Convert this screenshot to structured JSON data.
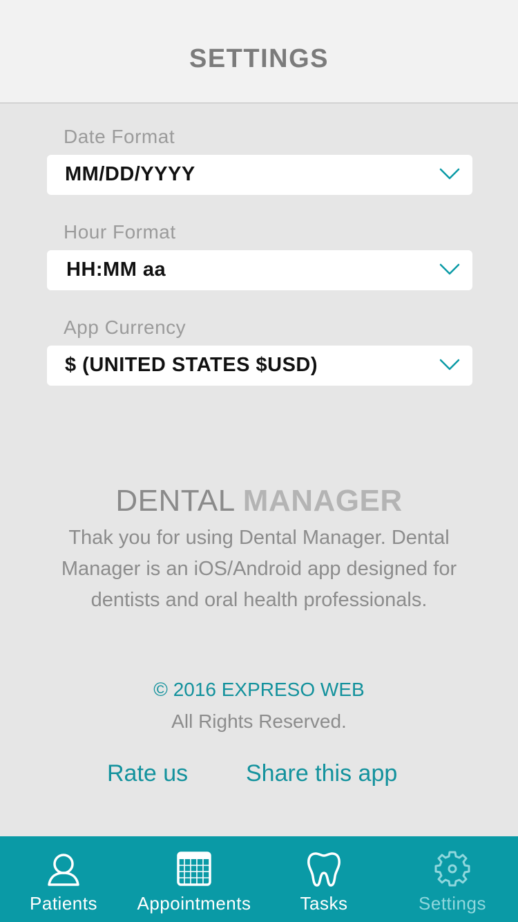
{
  "header": {
    "title": "SETTINGS"
  },
  "fields": {
    "date_format": {
      "label": "Date Format",
      "value": "MM/DD/YYYY"
    },
    "hour_format": {
      "label": "Hour Format",
      "value": "HH:MM aa"
    },
    "currency": {
      "label": "App Currency",
      "value": "$ (UNITED STATES $USD)"
    }
  },
  "about": {
    "brand_part1": "DENTAL",
    "brand_part2": "MANAGER",
    "description": "Thak you for using Dental Manager. Dental Manager is an iOS/Android app designed for dentists and oral health professionals.",
    "copyright": "© 2016 EXPRESO WEB",
    "rights": "All Rights Reserved."
  },
  "links": {
    "rate": "Rate us",
    "share": "Share this app"
  },
  "tabbar": {
    "patients": {
      "label": "Patients",
      "icon": "person-icon"
    },
    "appointments": {
      "label": "Appointments",
      "icon": "calendar-icon"
    },
    "tasks": {
      "label": "Tasks",
      "icon": "tooth-icon"
    },
    "settings": {
      "label": "Settings",
      "icon": "gear-icon"
    }
  },
  "colors": {
    "accent": "#0a9aa6",
    "link": "#13929d",
    "active_tab": "#8fd7dd"
  }
}
